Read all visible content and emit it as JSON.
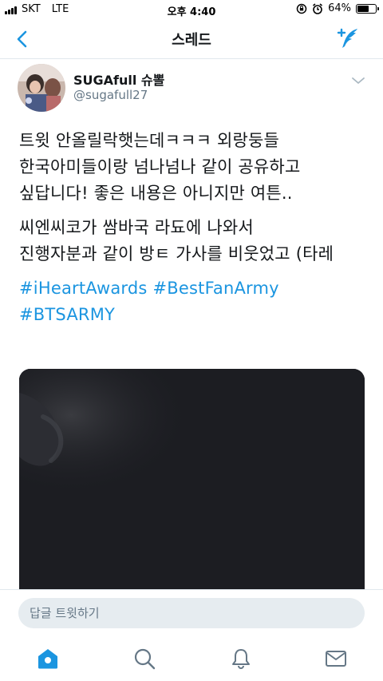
{
  "status_bar": {
    "carrier": "SKT",
    "network": "LTE",
    "time": "오후 4:40",
    "battery_percent": "64%",
    "battery_level": 0.64
  },
  "nav": {
    "title": "스레드"
  },
  "tweet": {
    "display_name": "SUGAfull 슈뽈",
    "handle": "@sugafull27",
    "lines_p1": [
      "트윗 안올릴락햇는데ㅋㅋㅋ 외랑둥들",
      "한국아미들이랑 넘나넘나 같이 공유하고",
      "싶답니다! 좋은 내용은 아니지만 여튼.."
    ],
    "lines_p2": [
      "씨엔씨코가 쌈바국 라됴에 나와서",
      "진행자분과 같이 방ㅌ 가사를 비웃었고 (타레"
    ],
    "hashtags": [
      "#iHeartAwards",
      "#BestFanArmy",
      "#BTSARMY"
    ]
  },
  "reply": {
    "placeholder": "답글 트윗하기"
  },
  "tabs": [
    {
      "icon": "home-icon"
    },
    {
      "icon": "search-icon"
    },
    {
      "icon": "bell-icon"
    },
    {
      "icon": "mail-icon"
    }
  ],
  "colors": {
    "accent": "#1b95e0",
    "text": "#14171a",
    "muted": "#657786"
  }
}
